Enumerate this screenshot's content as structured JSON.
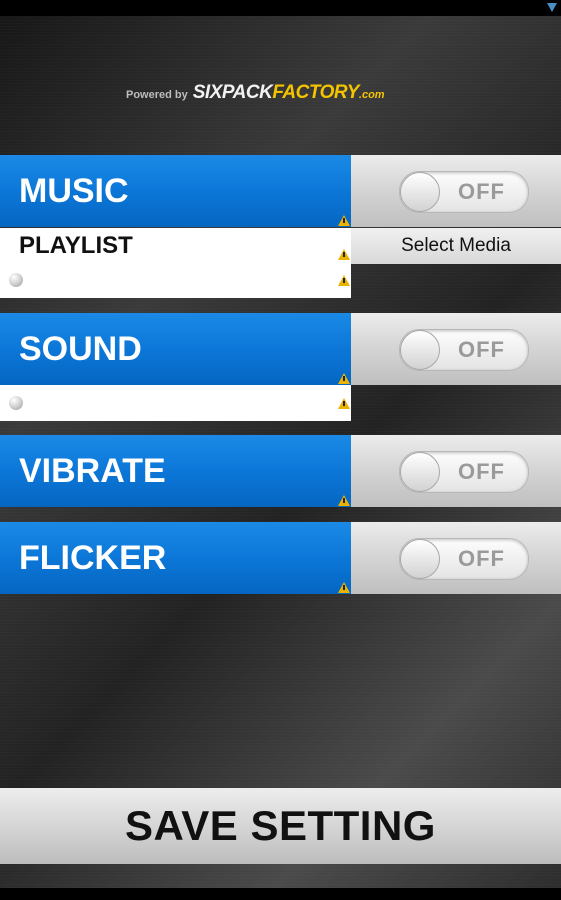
{
  "colors": {
    "accent_blue": "#0c77d8",
    "brand_yellow": "#f5c400",
    "warning": "#e8b400"
  },
  "logo": {
    "powered_by": "Powered by",
    "brand_part1": "SIXPACK",
    "brand_part2": "FACTORY",
    "brand_part3": ".com"
  },
  "sections": {
    "music": {
      "title": "MUSIC",
      "toggle_label": "OFF",
      "toggle_on": false
    },
    "playlist": {
      "label": "PLAYLIST",
      "select_label": "Select Media"
    },
    "sound": {
      "title": "SOUND",
      "toggle_label": "OFF",
      "toggle_on": false
    },
    "vibrate": {
      "title": "VIBRATE",
      "toggle_label": "OFF",
      "toggle_on": false
    },
    "flicker": {
      "title": "FLICKER",
      "toggle_label": "OFF",
      "toggle_on": false
    }
  },
  "icons": [
    "warning-icon",
    "radio-dot-icon",
    "signal-icon"
  ],
  "save_button": {
    "label": "SAVE SETTING"
  }
}
